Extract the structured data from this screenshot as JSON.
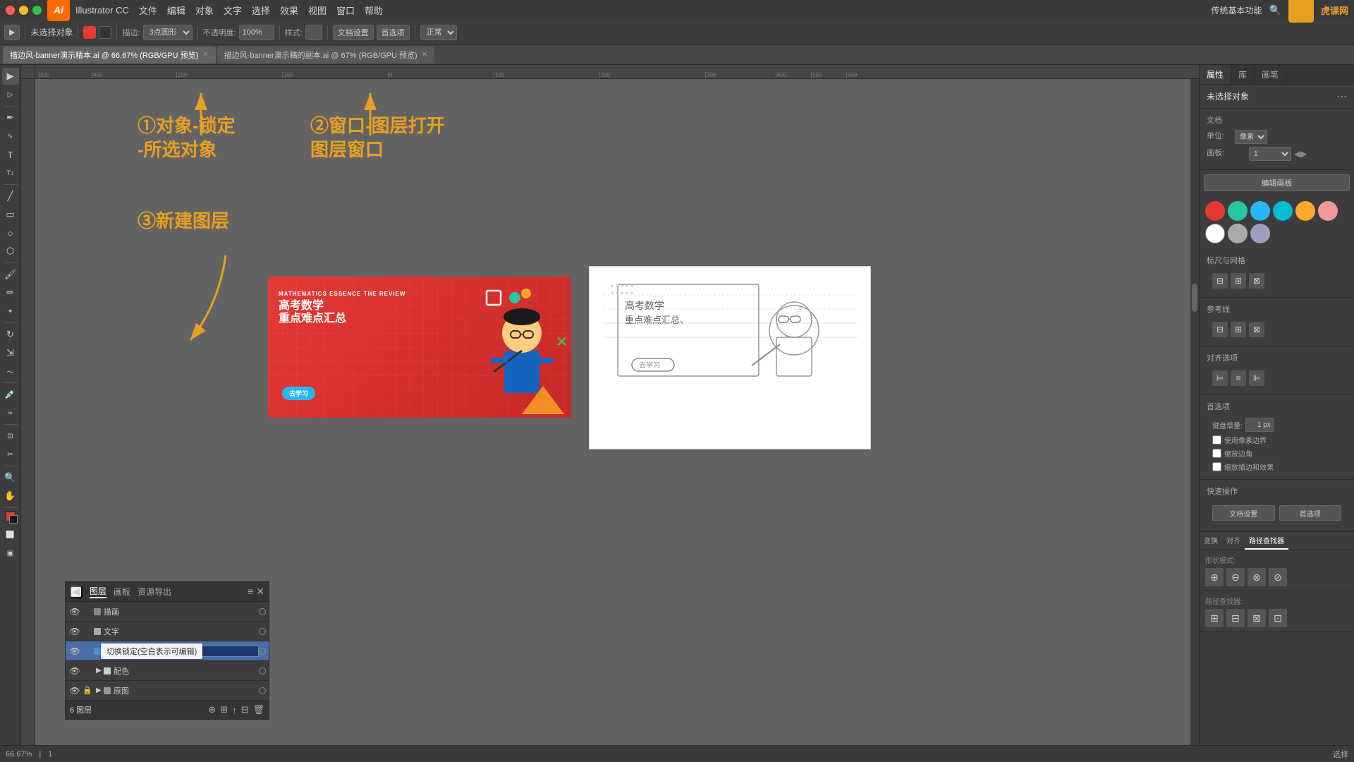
{
  "app": {
    "name": "Illustrator CC",
    "ai_label": "Ai",
    "version_area": "传统基本功能",
    "huke_site": "虎课网"
  },
  "menu": {
    "apple": "🍎",
    "items": [
      "Illustrator CC",
      "文件",
      "编辑",
      "对象",
      "文字",
      "选择",
      "效果",
      "视图",
      "窗口",
      "帮助"
    ]
  },
  "toolbar": {
    "no_selection": "未选择对象",
    "stroke_label": "描边:",
    "stroke_value": "3点圆形",
    "opacity_label": "不透明度:",
    "opacity_value": "100%",
    "style_label": "样式:",
    "doc_settings": "文档设置",
    "preferences": "首选项"
  },
  "tabs": [
    {
      "name": "描边风-banner演示精本.ai @ 66.67% (RGB/GPU 预览)",
      "active": true
    },
    {
      "name": "描边风-banner演示稿的副本.ai @ 67% (RGB/GPU 预览)",
      "active": false
    }
  ],
  "canvas": {
    "zoom": "66.67%",
    "page": "1",
    "select_label": "选择"
  },
  "annotations": {
    "step1": "①对象-锁定\n-所选对象",
    "step2": "②窗口-图层打开\n图层窗口",
    "step3": "③新建图层"
  },
  "layers_panel": {
    "tabs": [
      "图层",
      "画板",
      "资源导出"
    ],
    "layers": [
      {
        "name": "描画",
        "visible": true,
        "locked": false,
        "color": "#888888"
      },
      {
        "name": "文字",
        "visible": true,
        "locked": false,
        "color": "#aaaaaa"
      },
      {
        "name": "",
        "visible": true,
        "locked": false,
        "color": "#4a90d9",
        "editing": true
      },
      {
        "name": "配色",
        "visible": true,
        "locked": false,
        "color": "#cccccc",
        "has_expand": true
      },
      {
        "name": "原图",
        "visible": true,
        "locked": true,
        "color": "#999999",
        "has_expand": true
      }
    ],
    "tooltip": "切换锁定(空白表示可编辑)",
    "footer": {
      "layer_count": "6 图层"
    },
    "footer_buttons": [
      "new_layer",
      "delete_layer",
      "move_up",
      "move_down"
    ]
  },
  "right_panel": {
    "tabs": [
      "属性",
      "库",
      "画笔"
    ],
    "title": "未选择对象",
    "doc_section": "文档",
    "unit_label": "单位:",
    "unit_value": "像素",
    "artboard_label": "画板:",
    "artboard_value": "1",
    "edit_template_btn": "编辑画板",
    "align_section": "标尺与网格",
    "guides_section": "参考线",
    "align_obj_section": "对齐选项",
    "preferences_section": "首选项",
    "keyboard_nudge_label": "键盘增量:",
    "keyboard_nudge_value": "1 px",
    "snap_label": "使用像素边界",
    "round_label": "缩放边角",
    "transform_label": "缩放描边和效果",
    "quick_actions_title": "快速操作",
    "doc_settings_btn": "文档设置",
    "preferences_btn": "首选项"
  },
  "color_swatches": [
    {
      "color": "#e53935",
      "name": "red"
    },
    {
      "color": "#26c6a5",
      "name": "teal"
    },
    {
      "color": "#29b6f6",
      "name": "light-blue"
    },
    {
      "color": "#29b6f6",
      "name": "cyan"
    },
    {
      "color": "#ffa726",
      "name": "orange"
    },
    {
      "color": "#ef9a9a",
      "name": "pink"
    },
    {
      "color": "#ffffff",
      "name": "white"
    },
    {
      "color": "#aaaaaa",
      "name": "gray"
    },
    {
      "color": "#9e9ec4",
      "name": "lavender"
    }
  ],
  "bottom_panel": {
    "section_tabs": [
      "变换",
      "对齐",
      "路径查找器"
    ],
    "active_tab": "路径查找器",
    "shape_mode_label": "形状模式:",
    "path_finder_label": "路径查找器:"
  },
  "banner": {
    "subtitle": "MATHEMATICS ESSENCE THE REVIEW",
    "title_line1": "高考数学",
    "title_line2": "重点难点汇总",
    "cta_button": "去学习"
  },
  "status_bar": {
    "zoom": "66.67%",
    "page": "1",
    "mode": "选择"
  }
}
